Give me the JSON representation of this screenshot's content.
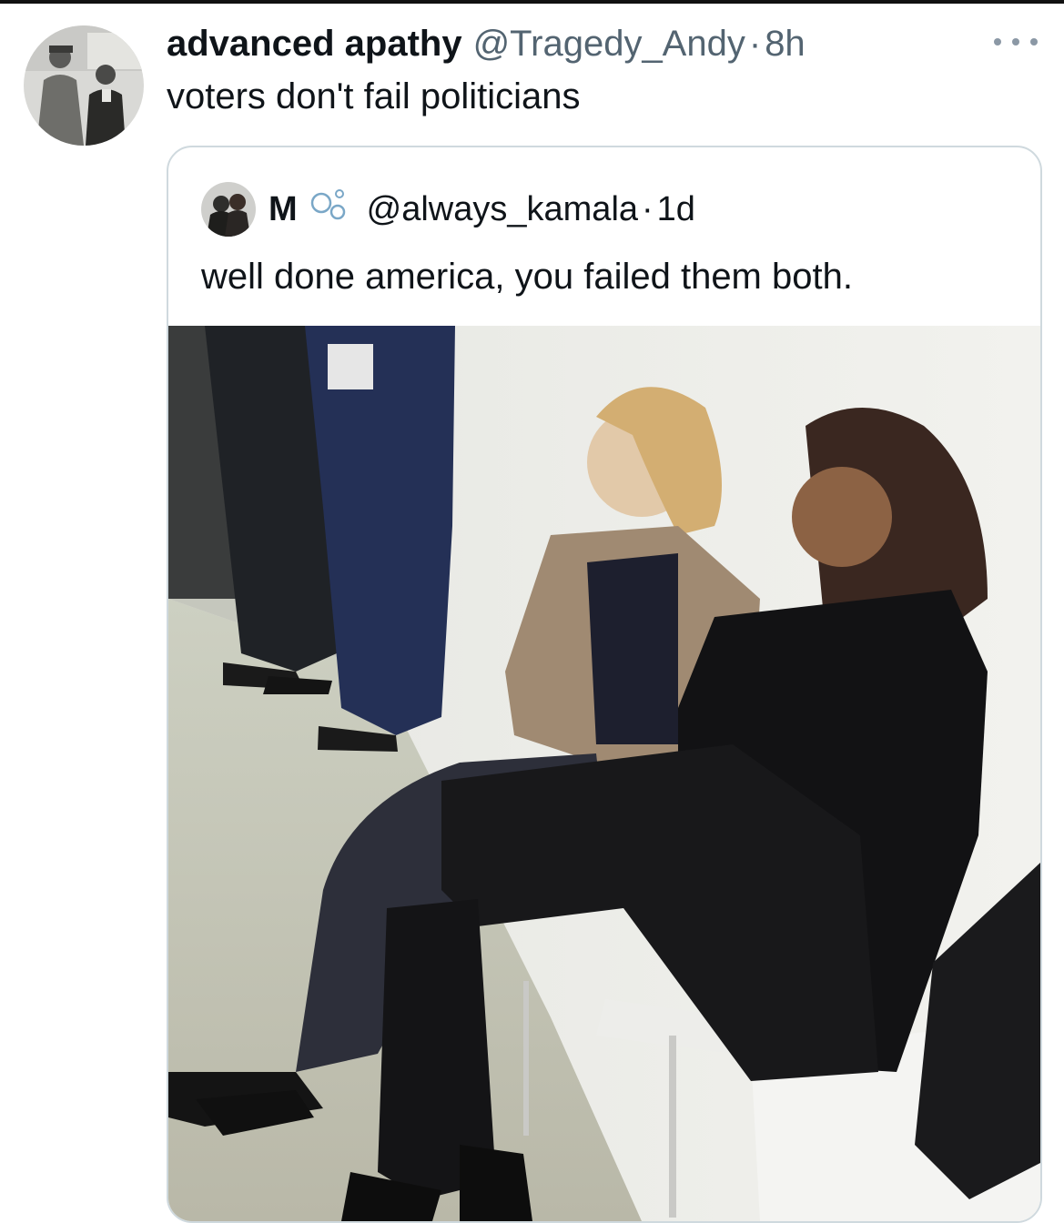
{
  "tweet": {
    "display_name": "advanced apathy",
    "handle": "@Tragedy_Andy",
    "separator": "·",
    "time": "8h",
    "text": "voters don't fail politicians",
    "avatar_icon": "profile-photo-avatar",
    "more_icon": "more-options-icon"
  },
  "quoted_tweet": {
    "display_name": "M",
    "name_icon": "bubbles-icon",
    "handle": "@always_kamala",
    "separator": "·",
    "time": "1d",
    "text": "well done america, you failed them both.",
    "media_icon": "attached-photo"
  }
}
